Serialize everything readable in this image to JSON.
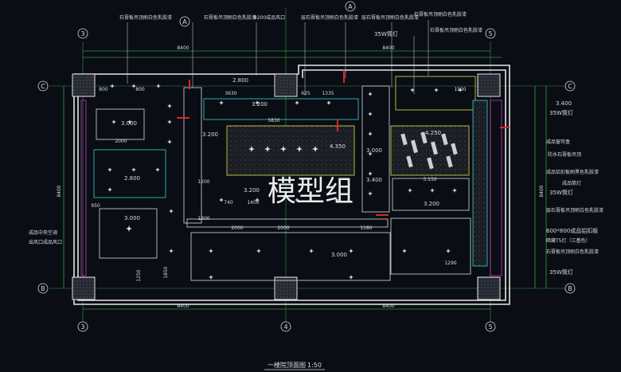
{
  "watermark": "模型组",
  "title_block": {
    "title": "一楼院顶面图",
    "scale": "1:50"
  },
  "grid_axes": {
    "col_3": "3",
    "col_4": "4",
    "col_5": "5",
    "col_A": "A",
    "row_C": "C",
    "row_B": "B"
  },
  "top_notes": [
    "石膏板吊顶刷白色乳胶漆",
    "石膏板吊顶刷白色乳胶漆",
    "Φ200成品风口",
    "层石膏板吊顶刷白色乳胶漆",
    "层石膏板吊顶刷白色乳胶漆",
    "石膏板吊顶刷白色乳胶漆",
    "35W筒灯",
    "石膏板吊顶刷白色乳胶漆"
  ],
  "right_notes": [
    "3.400",
    "35W筒灯",
    "成品窗帘盒",
    "防水石膏板吊顶",
    "成品铝扣板刷黑色乳胶漆",
    "成品筒灯",
    "35W筒灯",
    "层石膏板吊顶刷白色乳胶漆",
    "600*800成品铝扣板",
    "暗藏T5灯（三基色）",
    "石膏板吊顶刷白色乳胶漆",
    "35W筒灯"
  ],
  "left_notes": [
    "成品中央空调",
    "出风口成品风口"
  ],
  "dimensions": {
    "overall_left": "8400",
    "overall_right": "8400",
    "side_height": "8400",
    "right_height": "8400",
    "d_2800": "2.800",
    "d_3200": "3.200",
    "d_3000": "3.000",
    "d_4350": "4.350",
    "d_2800b": "2.800",
    "d_3000b": "3.000",
    "d_3000c": "3.000",
    "d_3200b": "3.200",
    "d_3000d": "3.000",
    "d_3400": "3.400",
    "d_4250": "4.250",
    "d_3150": "3.150",
    "d_800": "800",
    "d_2000": "2000",
    "d_1400": "1400",
    "d_1180": "1180",
    "d_5830": "5830",
    "d_3630": "3630",
    "d_1335": "1335",
    "d_625": "625",
    "d_1500": "1500",
    "d_1200": "1200",
    "d_1300": "1300",
    "d_950": "950",
    "d_1250": "1250",
    "d_1850": "1850",
    "d_1290": "1290",
    "d_740": "740"
  },
  "colors": {
    "background": "#0a0d14",
    "wall": "#e6e6e6",
    "cyan": "#33d1d1",
    "yellow": "#e0e044",
    "green": "#3fd050",
    "magenta": "#c63ac6",
    "red": "#e02525",
    "white": "#d8dbe3"
  }
}
